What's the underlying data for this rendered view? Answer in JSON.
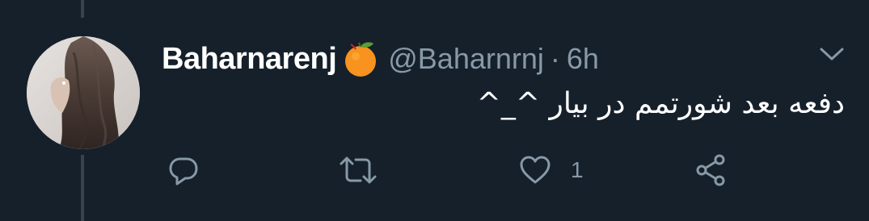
{
  "tweet": {
    "display_name": "Baharnarenj",
    "name_emoji": "orange-emoji-icon",
    "handle": "@Baharnrnj",
    "separator": "·",
    "timestamp": "6h",
    "text": "دفعه بعد شورتمم در بیار ^_^",
    "actions": {
      "reply_icon": "reply-icon",
      "retweet_icon": "retweet-icon",
      "like_icon": "heart-icon",
      "like_count": "1",
      "share_icon": "share-icon"
    }
  },
  "colors": {
    "background": "#15202b",
    "primary_text": "#ffffff",
    "secondary_text": "#8899a6",
    "thread_line": "#38444d",
    "emoji_orange": "#f7931e",
    "emoji_leaf": "#5c9e31"
  }
}
